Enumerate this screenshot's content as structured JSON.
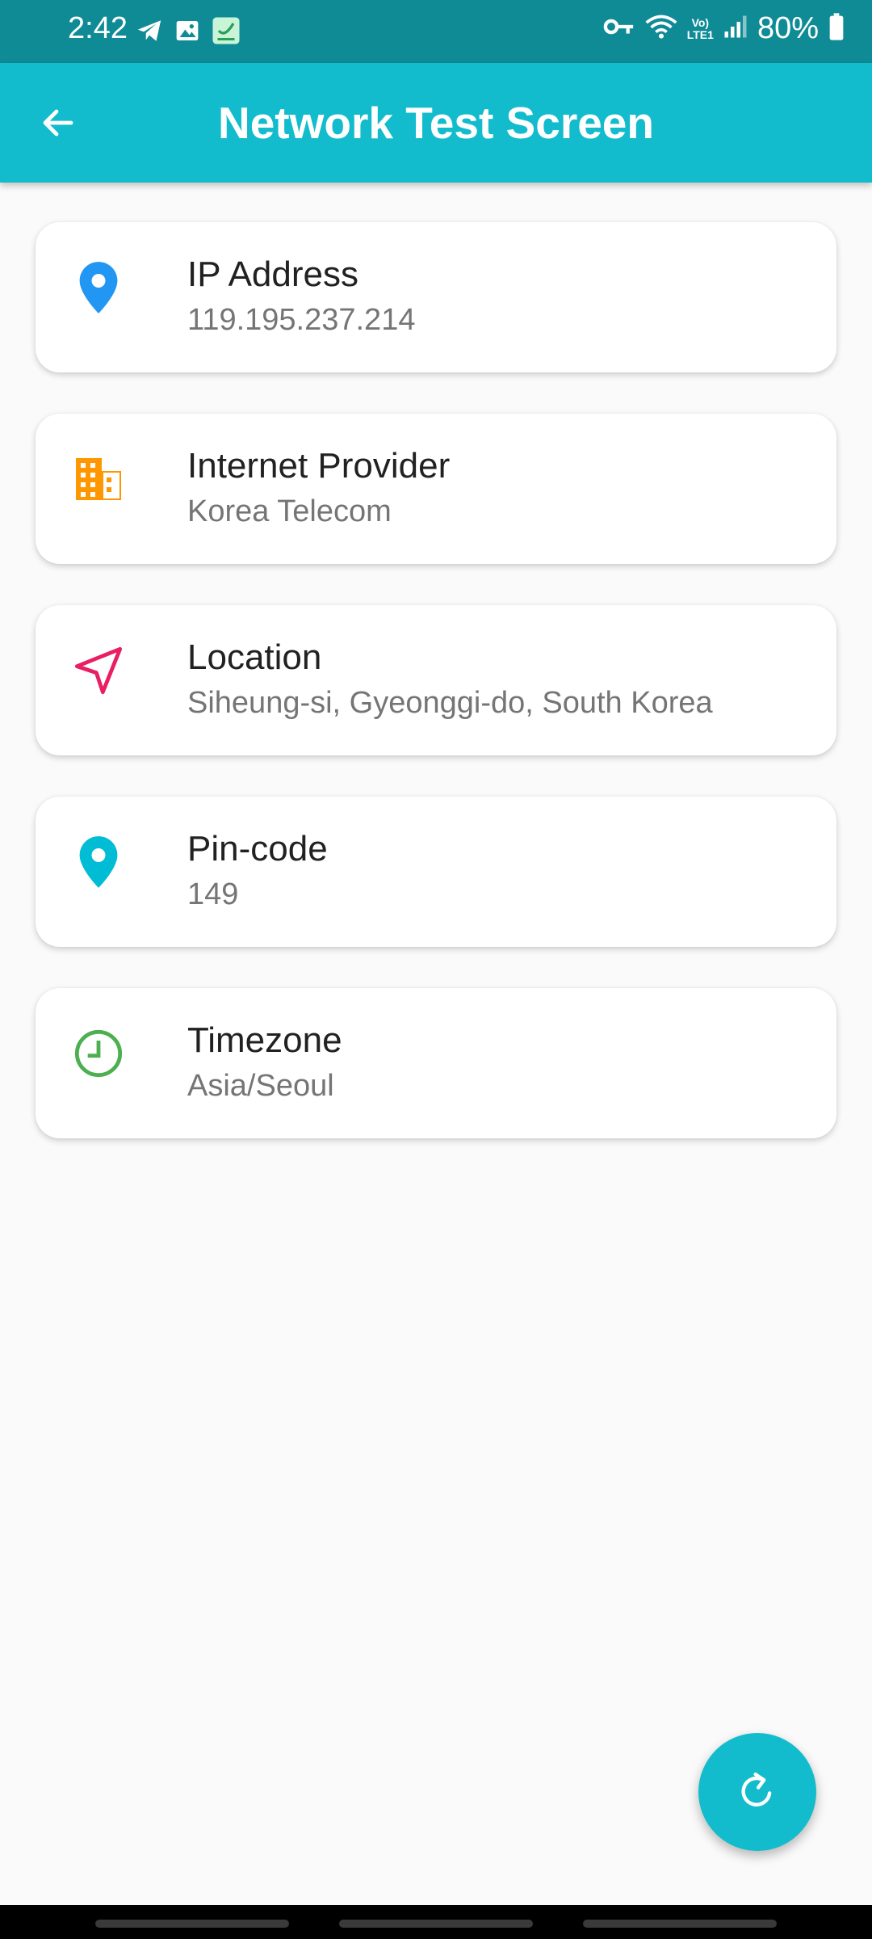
{
  "status_bar": {
    "time": "2:42",
    "battery": "80%",
    "network_label_top": "Vo)",
    "network_label_bottom": "LTE1",
    "background": "#0f8b96"
  },
  "app_bar": {
    "title": "Network Test Screen",
    "back_icon": "arrow-left-icon",
    "background": "#12bccc"
  },
  "cards": [
    {
      "icon": "map-pin-icon",
      "icon_color": "#2196f3",
      "title": "IP Address",
      "value": "119.195.237.214"
    },
    {
      "icon": "building-icon",
      "icon_color": "#ff9800",
      "title": "Internet Provider",
      "value": "Korea Telecom"
    },
    {
      "icon": "navigation-arrow-icon",
      "icon_color": "#e91e63",
      "title": "Location",
      "value": "Siheung-si, Gyeonggi-do, South Korea"
    },
    {
      "icon": "map-pin-icon",
      "icon_color": "#00bcd4",
      "title": "Pin-code",
      "value": "149"
    },
    {
      "icon": "clock-icon",
      "icon_color": "#4caf50",
      "title": "Timezone",
      "value": "Asia/Seoul"
    }
  ],
  "fab": {
    "icon": "refresh-icon",
    "background": "#12bccc"
  }
}
